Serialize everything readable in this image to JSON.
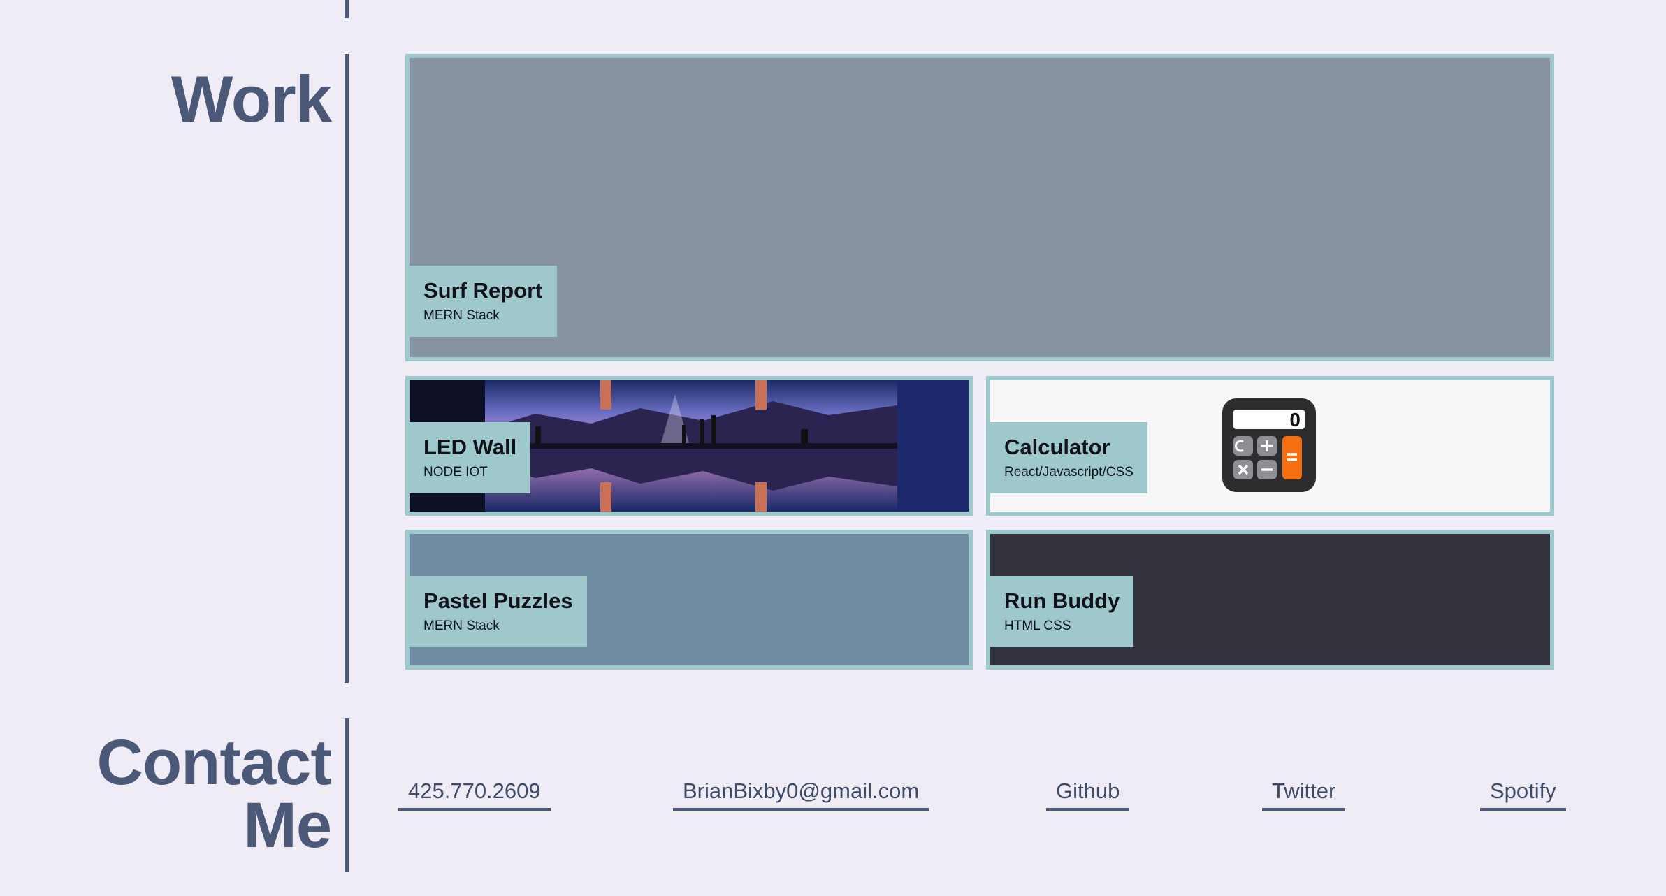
{
  "work": {
    "heading": "Work",
    "projects": [
      {
        "title": "Surf Report",
        "stack": "MERN Stack"
      },
      {
        "title": "LED Wall",
        "stack": "NODE IOT"
      },
      {
        "title": "Calculator",
        "stack": "React/Javascript/CSS",
        "icon_display": "0"
      },
      {
        "title": "Pastel Puzzles",
        "stack": "MERN Stack"
      },
      {
        "title": "Run Buddy",
        "stack": "HTML CSS"
      }
    ]
  },
  "contact": {
    "heading_line1": "Contact",
    "heading_line2": "Me",
    "links": {
      "phone": "425.770.2609",
      "email": "BrianBixby0@gmail.com",
      "github": "Github",
      "twitter": "Twitter",
      "spotify": "Spotify"
    }
  },
  "colors": {
    "background": "#efecf6",
    "accent_line": "#4b5878",
    "card_border": "#9fc8cc",
    "surf_bg": "#8692a1",
    "pastel_bg": "#708ca2",
    "run_bg": "#32333d",
    "calc_bg": "#f7f7f7"
  },
  "icons": {
    "calculator": "calculator-icon",
    "led_wall": "led-wall-image"
  }
}
